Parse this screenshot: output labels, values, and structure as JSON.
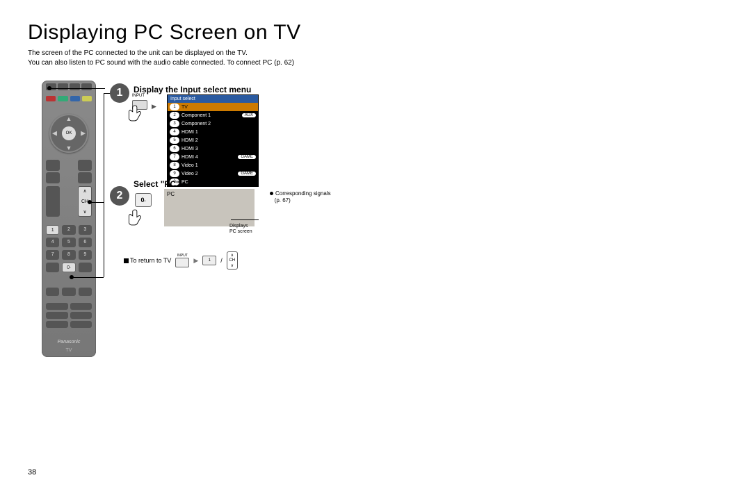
{
  "title": "Displaying PC Screen on TV",
  "intro_line1": "The screen of the PC connected to the unit can be displayed on the TV.",
  "intro_line2": "You can also listen to PC sound with the audio cable connected. To connect PC (p. 62)",
  "page_number": "38",
  "remote": {
    "ok": "OK",
    "ch": "CH",
    "brand": "Panasonic",
    "tv": "TV",
    "key1": "1",
    "key0": "0",
    "key0sub": "-"
  },
  "step1": {
    "num": "1",
    "title": "Display the Input select menu",
    "input_btn_label": "INPUT",
    "input_btn": " "
  },
  "input_menu": {
    "header": "Input select",
    "rows": [
      {
        "n": "1",
        "label": "TV",
        "badge": "",
        "sel": true
      },
      {
        "n": "2",
        "label": "Component 1",
        "badge": "AUX"
      },
      {
        "n": "3",
        "label": "Component 2",
        "badge": ""
      },
      {
        "n": "4",
        "label": "HDMI 1",
        "badge": ""
      },
      {
        "n": "5",
        "label": "HDMI 2",
        "badge": ""
      },
      {
        "n": "6",
        "label": "HDMI 3",
        "badge": ""
      },
      {
        "n": "7",
        "label": "HDMI 4",
        "badge": "GAME"
      },
      {
        "n": "8",
        "label": "Video 1",
        "badge": ""
      },
      {
        "n": "9",
        "label": "Video 2",
        "badge": "GAME"
      },
      {
        "n": "0",
        "label": "PC",
        "badge": ""
      }
    ]
  },
  "step2": {
    "num": "2",
    "title": "Select \"PC\"",
    "key": "0",
    "keysub": "-",
    "pc_label": "PC",
    "displays_note1": "Displays",
    "displays_note2": "PC screen",
    "signals1": "Corresponding signals",
    "signals2": "(p. 67)"
  },
  "return": {
    "label": "To return to TV",
    "input_top": "INPUT",
    "key1": "1",
    "slash": "/",
    "ch": "CH"
  }
}
